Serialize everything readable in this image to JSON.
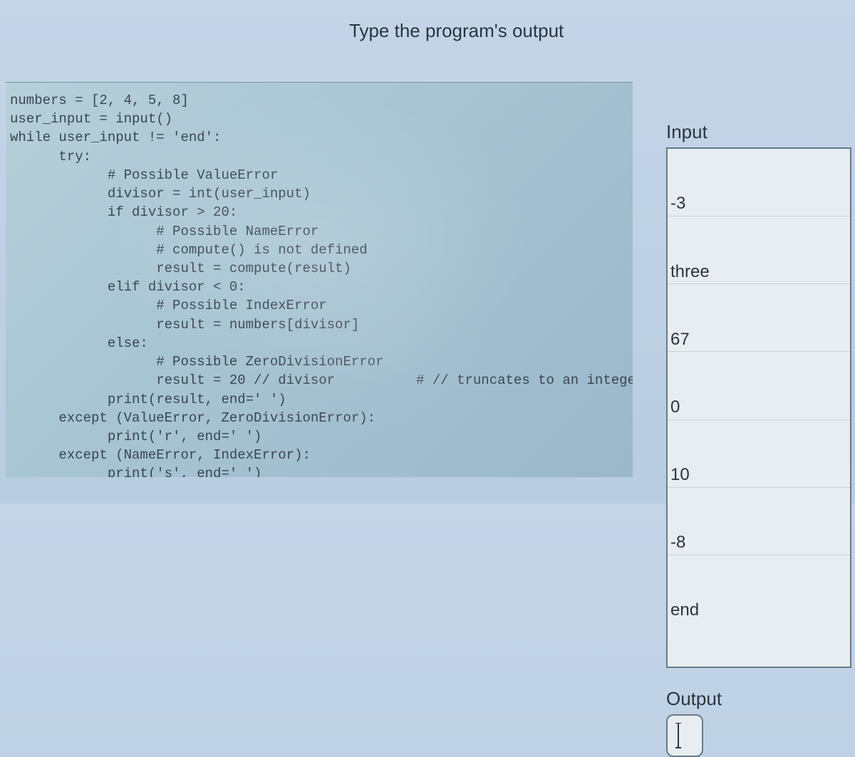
{
  "heading": "Type the program's output",
  "code": "numbers = [2, 4, 5, 8]\nuser_input = input()\nwhile user_input != 'end':\n      try:\n            # Possible ValueError\n            divisor = int(user_input)\n            if divisor > 20:\n                  # Possible NameError\n                  # compute() is not defined\n                  result = compute(result)\n            elif divisor < 0:\n                  # Possible IndexError\n                  result = numbers[divisor]\n            else:\n                  # Possible ZeroDivisionError\n                  result = 20 // divisor          # // truncates to an integer\n            print(result, end=' ')\n      except (ValueError, ZeroDivisionError):\n            print('r', end=' ')\n      except (NameError, IndexError):\n            print('s', end=' ')\n      user_input = input()\nprint('OK')",
  "input": {
    "label": "Input",
    "lines": [
      "-3",
      "three",
      "67",
      "0",
      "10",
      "-8",
      "end"
    ]
  },
  "output": {
    "label": "Output",
    "value": ""
  }
}
